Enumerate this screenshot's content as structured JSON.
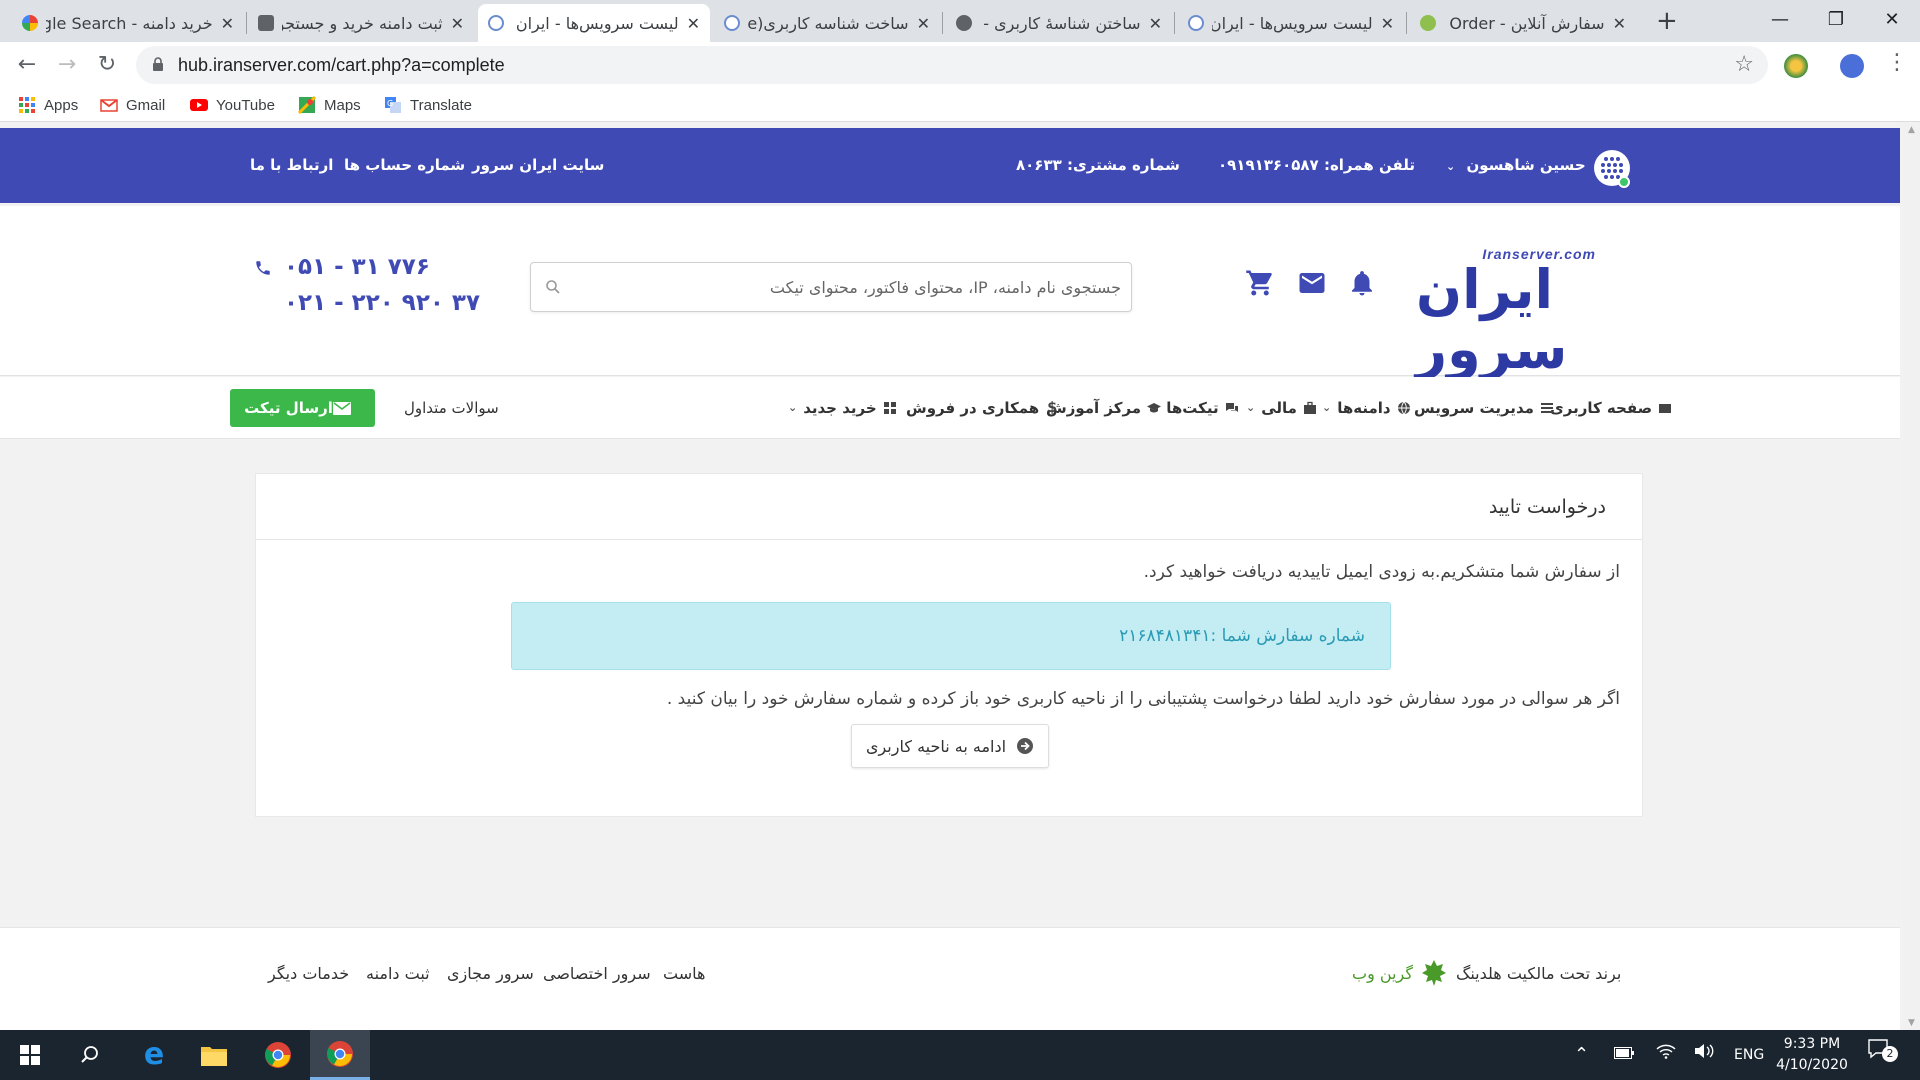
{
  "browser": {
    "tabs": [
      {
        "title": "خرید دامنه - Google Search",
        "active": false
      },
      {
        "title": "ثبت دامنه خرید و جستجو",
        "active": false
      },
      {
        "title": "لیست سرویس‌ها - ایران سرور",
        "active": true
      },
      {
        "title": "ساخت شناسه کاربری(Nic Handle)",
        "active": false
      },
      {
        "title": "ساختن شناسهٔ کاربری - ایرنیک",
        "active": false
      },
      {
        "title": "لیست سرویس‌ها - ایران سرور",
        "active": false
      },
      {
        "title": "سفارش آنلاین - Online Order",
        "active": false
      }
    ],
    "close_glyph": "✕",
    "new_tab_glyph": "+",
    "url": "hub.iranserver.com/cart.php?a=complete",
    "bookmarks": [
      "Apps",
      "Gmail",
      "YouTube",
      "Maps",
      "Translate"
    ]
  },
  "topbar": {
    "user_name": "حسین شاهسون",
    "mobile": "تلفن همراه: ۰۹۱۹۱۳۶۰۵۸۷",
    "customer_no": "شماره مشتری: ۸۰۶۳۳",
    "links": [
      "سایت ایران سرور",
      "شماره حساب ها",
      "ارتباط با ما"
    ]
  },
  "header": {
    "logo_small": "Iranserver.com",
    "logo_main": "ایران سرور",
    "search_placeholder": "جستجوی نام دامنه، IP، محتوای فاکتور، محتوای تیکت",
    "phone_1": "۰۵۱ - ۳۱ ۷۷۶",
    "phone_2": "۰۲۱ - ۲۲۰ ۹۲۰ ۳۷"
  },
  "menu": {
    "items": [
      {
        "label": "صفحه کاربری",
        "icon": "dashboard-icon",
        "dropdown": false
      },
      {
        "label": "مدیریت سرویس",
        "icon": "list-icon",
        "dropdown": false
      },
      {
        "label": "دامنه‌ها",
        "icon": "globe-icon",
        "dropdown": true
      },
      {
        "label": "مالی",
        "icon": "briefcase-icon",
        "dropdown": true
      },
      {
        "label": "تیکت‌ها",
        "icon": "comments-icon",
        "dropdown": true
      },
      {
        "label": "مرکز آموزش",
        "icon": "graduation-icon",
        "dropdown": false
      },
      {
        "label": "همکاری در فروش",
        "icon": "dollar-icon",
        "dropdown": false
      },
      {
        "label": "خرید جدید",
        "icon": "grid-icon",
        "dropdown": true
      }
    ],
    "faq": "سوالات متداول",
    "send_ticket": "ارسال تیکت"
  },
  "card": {
    "title": "درخواست تایید",
    "thanks": "از سفارش شما متشکریم.به زودی ایمیل تاییدیه دریافت خواهید کرد.",
    "order_number": "شماره سفارش شما :۲۱۶۸۴۸۱۳۴۱",
    "help": "اگر هر سوالی در مورد سفارش خود دارید لطفا درخواست پشتیبانی را از ناحیه کاربری خود باز کرده و شماره سفارش خود را بیان کنید .",
    "continue": "ادامه به ناحیه کاربری"
  },
  "footer": {
    "brand_text": "برند تحت مالکیت هلدینگ",
    "brand_name": "گرین وب",
    "links": [
      "هاست",
      "سرور اختصاصی",
      "سرور مجازی",
      "ثبت دامنه",
      "خدمات دیگر"
    ]
  },
  "taskbar": {
    "language": "ENG",
    "time": "9:33 PM",
    "date": "4/10/2020",
    "notification_count": "2"
  },
  "colors": {
    "brand_blue": "#3f4ab5",
    "ticket_green": "#3cb84a",
    "info_bg": "#c4ecf3",
    "info_text": "#2a9bb5"
  }
}
